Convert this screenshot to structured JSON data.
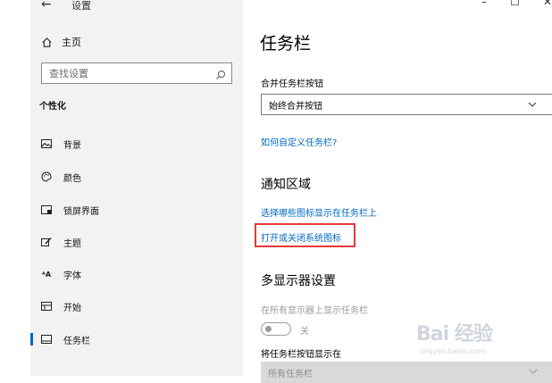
{
  "window": {
    "title": "设置",
    "controls": {
      "minimize": "–",
      "maximize": "☐",
      "close": "✕"
    }
  },
  "sidebar": {
    "home_label": "主页",
    "search": {
      "placeholder": "查找设置"
    },
    "section_heading": "个性化",
    "items": [
      {
        "label": "背景",
        "icon": "image-icon"
      },
      {
        "label": "颜色",
        "icon": "palette-icon"
      },
      {
        "label": "锁屏界面",
        "icon": "lock-screen-icon"
      },
      {
        "label": "主题",
        "icon": "theme-brush-icon"
      },
      {
        "label": "字体",
        "icon": "font-icon"
      },
      {
        "label": "开始",
        "icon": "start-menu-icon"
      },
      {
        "label": "任务栏",
        "icon": "taskbar-icon",
        "active": true
      }
    ]
  },
  "main": {
    "title": "任务栏",
    "combine": {
      "label": "合并任务栏按钮",
      "value": "始终合并按钮",
      "help_link": "如何自定义任务栏?"
    },
    "notification_area": {
      "title": "通知区域",
      "link_icons": "选择哪些图标显示在任务栏上",
      "link_system_icons": "打开或关闭系统图标"
    },
    "multi_display": {
      "title": "多显示器设置",
      "show_on_all_label": "在所有显示器上显示任务栏",
      "toggle_state": "关",
      "show_buttons_label": "将任务栏按钮显示在",
      "show_buttons_value": "所有任务栏"
    }
  },
  "watermark": {
    "brand": "Bai 经验",
    "url": "jingyan.baidu.com"
  },
  "colors": {
    "accent": "#0067c0",
    "highlight": "#e53935",
    "sidebar_bg": "#f2f2f2"
  }
}
